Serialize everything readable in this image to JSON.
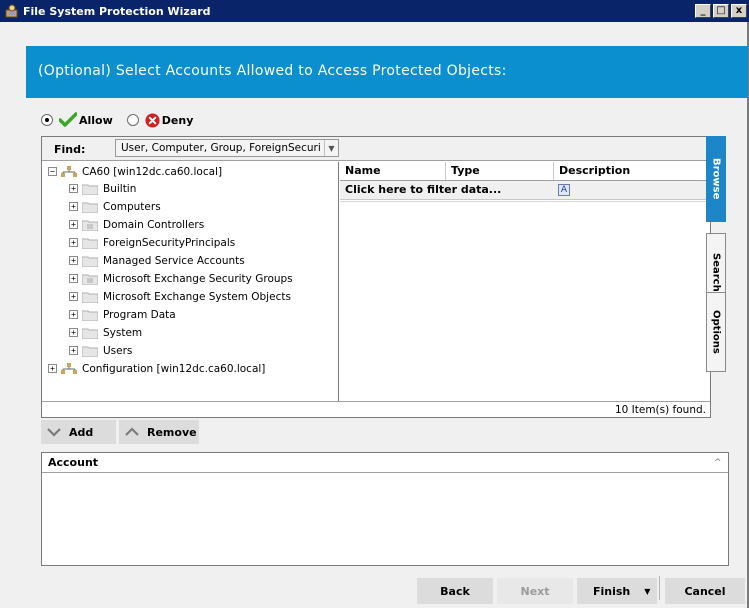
{
  "window": {
    "title": "File System Protection Wizard",
    "controls": [
      "_",
      "□",
      "x"
    ]
  },
  "header": {
    "title": "(Optional) Select Accounts Allowed to Access Protected Objects:"
  },
  "mode": {
    "allow_label": "Allow",
    "deny_label": "Deny",
    "selected": "allow",
    "allow_color": "#3ca52a",
    "deny_color": "#d01f1f"
  },
  "find": {
    "label": "Find:",
    "value": "User, Computer, Group, ForeignSecuri"
  },
  "tree": {
    "root": "CA60 [win12dc.ca60.local]",
    "children": [
      "Builtin",
      "Computers",
      "Domain Controllers",
      "ForeignSecurityPrincipals",
      "Managed Service Accounts",
      "Microsoft Exchange Security Groups",
      "Microsoft Exchange System Objects",
      "Program Data",
      "System",
      "Users"
    ],
    "second_root": "Configuration [win12dc.ca60.local]"
  },
  "grid": {
    "columns": [
      "Name",
      "Type",
      "Description"
    ],
    "filter_text": "Click here to filter data...",
    "filter_icon": "A"
  },
  "status": {
    "count": "10  Item(s) found."
  },
  "tabs": [
    "Browse",
    "Search",
    "Options"
  ],
  "buttons": {
    "add": "Add",
    "remove": "Remove",
    "back": "Back",
    "next": "Next",
    "finish": "Finish",
    "cancel": "Cancel"
  },
  "accounts": {
    "header": "Account"
  },
  "colors": {
    "header_band": "#0c8fcf",
    "active_tab": "#1c86c9",
    "titlebar": "#0a246a"
  }
}
